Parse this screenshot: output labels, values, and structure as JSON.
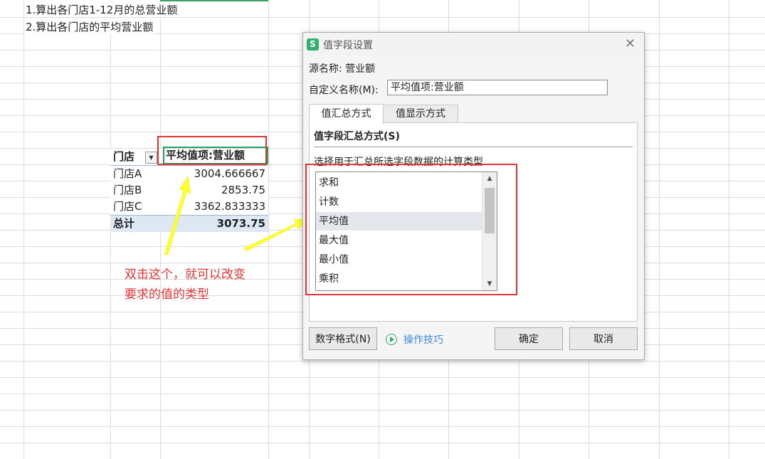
{
  "sheet": {
    "instruction_1": "1.算出各门店1-12月的总营业额",
    "instruction_2": "2.算出各门店的平均营业额"
  },
  "pivot": {
    "header_store": "门店",
    "header_value": "平均值项:营业额",
    "rows": [
      {
        "store": "门店A",
        "value": "3004.666667"
      },
      {
        "store": "门店B",
        "value": "2853.75"
      },
      {
        "store": "门店C",
        "value": "3362.833333"
      }
    ],
    "total_label": "总计",
    "total_value": "3073.75"
  },
  "annotation": {
    "line1": "双击这个，就可以改变",
    "line2": "要求的值的类型",
    "color": "#e53333"
  },
  "dialog": {
    "title": "值字段设置",
    "app_icon_glyph": "S",
    "close_glyph": "✕",
    "source_label": "源名称:",
    "source_value": "营业额",
    "custom_name_label": "自定义名称(M):",
    "custom_name_value": "平均值项:营业额",
    "tabs": [
      "值汇总方式",
      "值显示方式"
    ],
    "active_tab": "值汇总方式",
    "section_title": "值字段汇总方式(S)",
    "section_desc": "选择用于汇总所选字段数据的计算类型",
    "functions": [
      "求和",
      "计数",
      "平均值",
      "最大值",
      "最小值",
      "乘积"
    ],
    "selected_function": "平均值",
    "number_format_button": "数字格式(N)",
    "tips_link": "操作技巧",
    "ok_button": "确定",
    "cancel_button": "取消",
    "accent_color": "#2fb06c",
    "link_color": "#3d89d8"
  }
}
